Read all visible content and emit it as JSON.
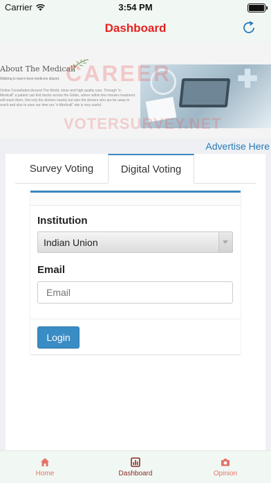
{
  "status_bar": {
    "carrier": "Carrier",
    "time": "3:54 PM"
  },
  "nav": {
    "title": "Dashboard",
    "refresh_icon": "refresh-icon",
    "title_color": "#e4211f"
  },
  "banner": {
    "heading": "About The Medicall",
    "tagline": "Walking is man's best medicine slipset.",
    "paragraph": "Online Consultation Around The World, clean and high quality care. Through \"e-Medicall\" a patient can find doctor across the Globe, where within few minutes treatment will reach them. Not only the doctors nearby but also the doctors who are far away to reach and also to save our time our \"e-Medicall\" site is very useful.",
    "watermark_top": "CAREER",
    "watermark_bottom": "VOTERSURVEY.NET"
  },
  "advertise_label": "Advertise Here",
  "tabs": [
    {
      "label": "Survey Voting",
      "active": false
    },
    {
      "label": "Digital Voting",
      "active": true
    }
  ],
  "form": {
    "institution_label": "Institution",
    "institution_value": "Indian Union",
    "email_label": "Email",
    "email_placeholder": "Email",
    "email_value": "",
    "login_label": "Login"
  },
  "tab_bar": [
    {
      "label": "Home",
      "icon": "home-icon"
    },
    {
      "label": "Dashboard",
      "icon": "chart-icon"
    },
    {
      "label": "Opinion",
      "icon": "camera-icon"
    }
  ],
  "colors": {
    "accent": "#3a87c1",
    "brand_red": "#e4211f",
    "tab_inactive": "#e4736a",
    "tab_active": "#8a2a25"
  }
}
